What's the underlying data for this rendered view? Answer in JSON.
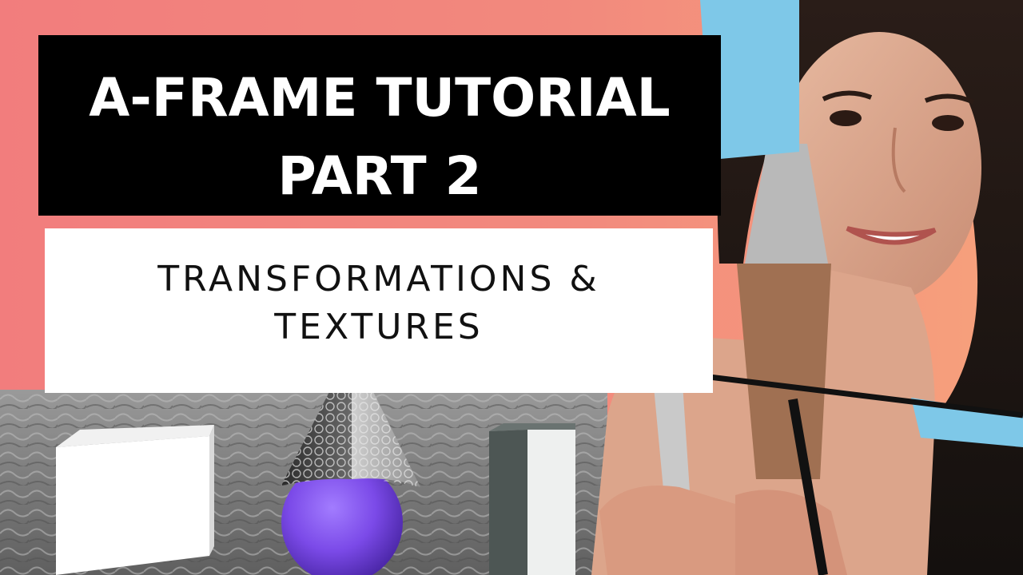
{
  "thumbnail": {
    "title": {
      "line1": "A-FRAME TUTORIAL",
      "line2": "PART 2"
    },
    "subtitle": {
      "line1": "TRANSFORMATIONS &",
      "line2": "TEXTURES"
    }
  },
  "colors": {
    "background": "#f2847d",
    "title_box": "#000000",
    "title_text": "#ffffff",
    "subtitle_box": "#ffffff",
    "subtitle_text": "#111111",
    "sphere": "#7b4ae8",
    "sky_tape": "#7ec8e8"
  },
  "icons": [
    "a-frame-scene-preview",
    "presenter-photo"
  ]
}
